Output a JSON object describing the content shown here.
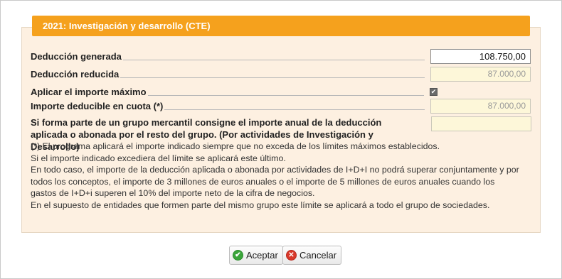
{
  "panel": {
    "title": "2021: Investigación y desarrollo (CTE)"
  },
  "fields": {
    "deduccion_generada": {
      "label": "Deducción generada",
      "value": "108.750,00"
    },
    "deduccion_reducida": {
      "label": "Deducción reducida",
      "value": "87.000,00"
    },
    "aplicar_maximo": {
      "label": "Aplicar el importe máximo",
      "checked": true,
      "check_glyph": "✔"
    },
    "importe_deducible": {
      "label": "Importe deducible en cuota (*)",
      "value": "87.000,00"
    },
    "grupo_mercantil": {
      "label": "Si forma parte de un grupo mercantil consigne el importe anual de la deducción aplicada o abonada por el resto del grupo. (Por actividades de Investigación y Desarrollo)",
      "value": ""
    }
  },
  "notes": [
    "(*) El programa aplicará el importe indicado siempre que no exceda de los límites máximos establecidos.",
    "Si el importe indicado excediera del límite se aplicará este último.",
    "En todo caso, el importe de la deducción aplicada o abonada por actividades de I+D+I no podrá superar conjuntamente y por todos los conceptos, el importe de 3 millones de euros anuales o el importe de 5 millones de euros anuales cuando los gastos de I+D+i superen el 10% del importe neto de la cifra de negocios.",
    "En el supuesto de entidades que formen parte del mismo grupo este límite se aplicará a todo el grupo de sociedades."
  ],
  "buttons": {
    "accept": {
      "label": "Aceptar",
      "icon": "check-circle-icon",
      "icon_glyph": "✔"
    },
    "cancel": {
      "label": "Cancelar",
      "icon": "x-circle-icon",
      "icon_glyph": "✕"
    }
  },
  "colors": {
    "header": "#f5a11d",
    "panel_bg": "#fdf0e1",
    "readonly_field_bg": "#fdf7d9"
  }
}
